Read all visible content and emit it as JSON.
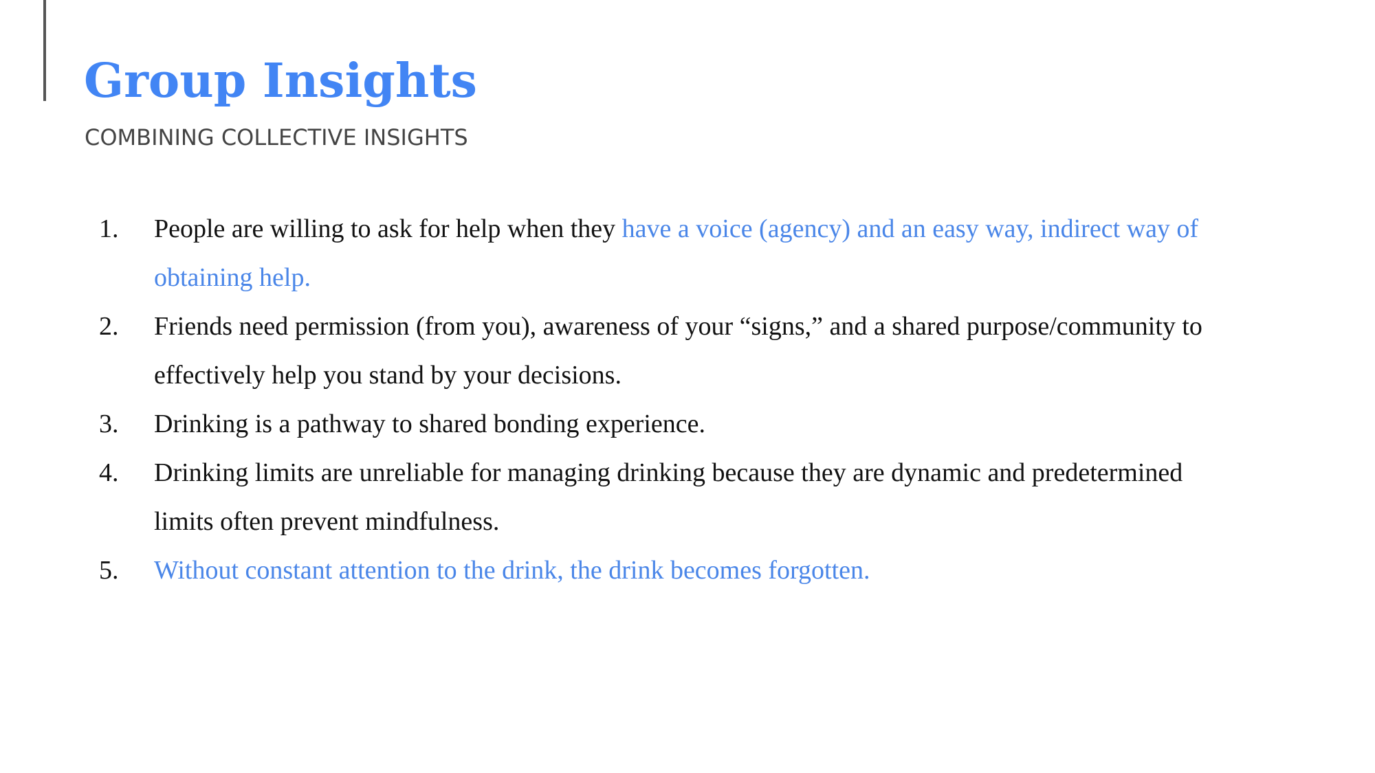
{
  "slide": {
    "title": "Group Insights",
    "subtitle": "COMBINING COLLECTIVE INSIGHTS",
    "colors": {
      "title": "#4285f4",
      "highlight": "#4a86e8",
      "body": "#111111",
      "subtitle": "#444444",
      "accent_bar": "#555555"
    }
  },
  "insights": [
    {
      "number": "1.",
      "text_plain": "People are willing to ask for help when they ",
      "text_highlight": "have a voice (agency) and an easy way, indirect way of obtaining help."
    },
    {
      "number": "2.",
      "text_plain": "Friends need permission (from you), awareness of your “signs,” and a shared purpose/community to effectively help you stand by your decisions."
    },
    {
      "number": "3.",
      "text_plain": "Drinking is a pathway to shared bonding experience."
    },
    {
      "number": "4.",
      "text_plain": "Drinking limits are unreliable for managing drinking because they are dynamic and predetermined limits often prevent mindfulness."
    },
    {
      "number": "5.",
      "text_highlight": "Without constant attention to the drink, the drink becomes forgotten."
    }
  ]
}
